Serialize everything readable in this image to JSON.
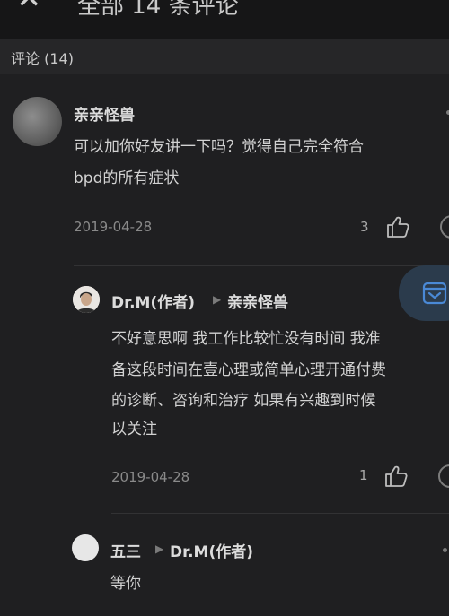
{
  "topbar": {
    "close_glyph": "✕",
    "title": "全部 14 条评论"
  },
  "section": {
    "label": "评论 (14)"
  },
  "comments": [
    {
      "nickname": "亲亲怪兽",
      "lines": [
        "可以加你好友讲一下吗？觉得自己完全符合",
        "bpd的所有症状"
      ],
      "date": "2019-04-28",
      "likes": "3"
    },
    {
      "nickname": "Dr.M(作者)",
      "reply_to": "亲亲怪兽",
      "lines": [
        "不好意思啊 我工作比较忙没有时间 我准",
        "备这段时间在壹心理或简单心理开通付费",
        "的诊断、咨询和治疗 如果有兴趣到时候",
        "以关注"
      ],
      "date": "2019-04-28",
      "likes": "1"
    },
    {
      "nickname": "五三",
      "reply_to": "Dr.M(作者)",
      "lines": [
        "等你"
      ]
    }
  ],
  "reply_arrow": "▶",
  "icons": {
    "like": "thumbs-up-icon",
    "float": "inbox-icon"
  },
  "colors": {
    "background": "#1f1f21",
    "accent": "#4a89d6"
  }
}
